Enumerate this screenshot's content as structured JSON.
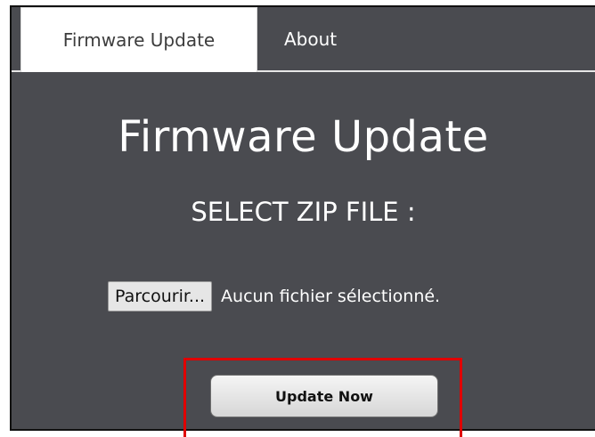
{
  "tabs": [
    {
      "label": "Firmware Update",
      "active": true
    },
    {
      "label": "About",
      "active": false
    }
  ],
  "main": {
    "title": "Firmware Update",
    "subtitle": "SELECT ZIP FILE :"
  },
  "file_picker": {
    "browse_label": "Parcourir...",
    "status_text": "Aucun fichier sélectionné."
  },
  "actions": {
    "update_label": "Update Now"
  },
  "colors": {
    "panel_background": "#4a4b50",
    "highlight": "#e00000"
  }
}
